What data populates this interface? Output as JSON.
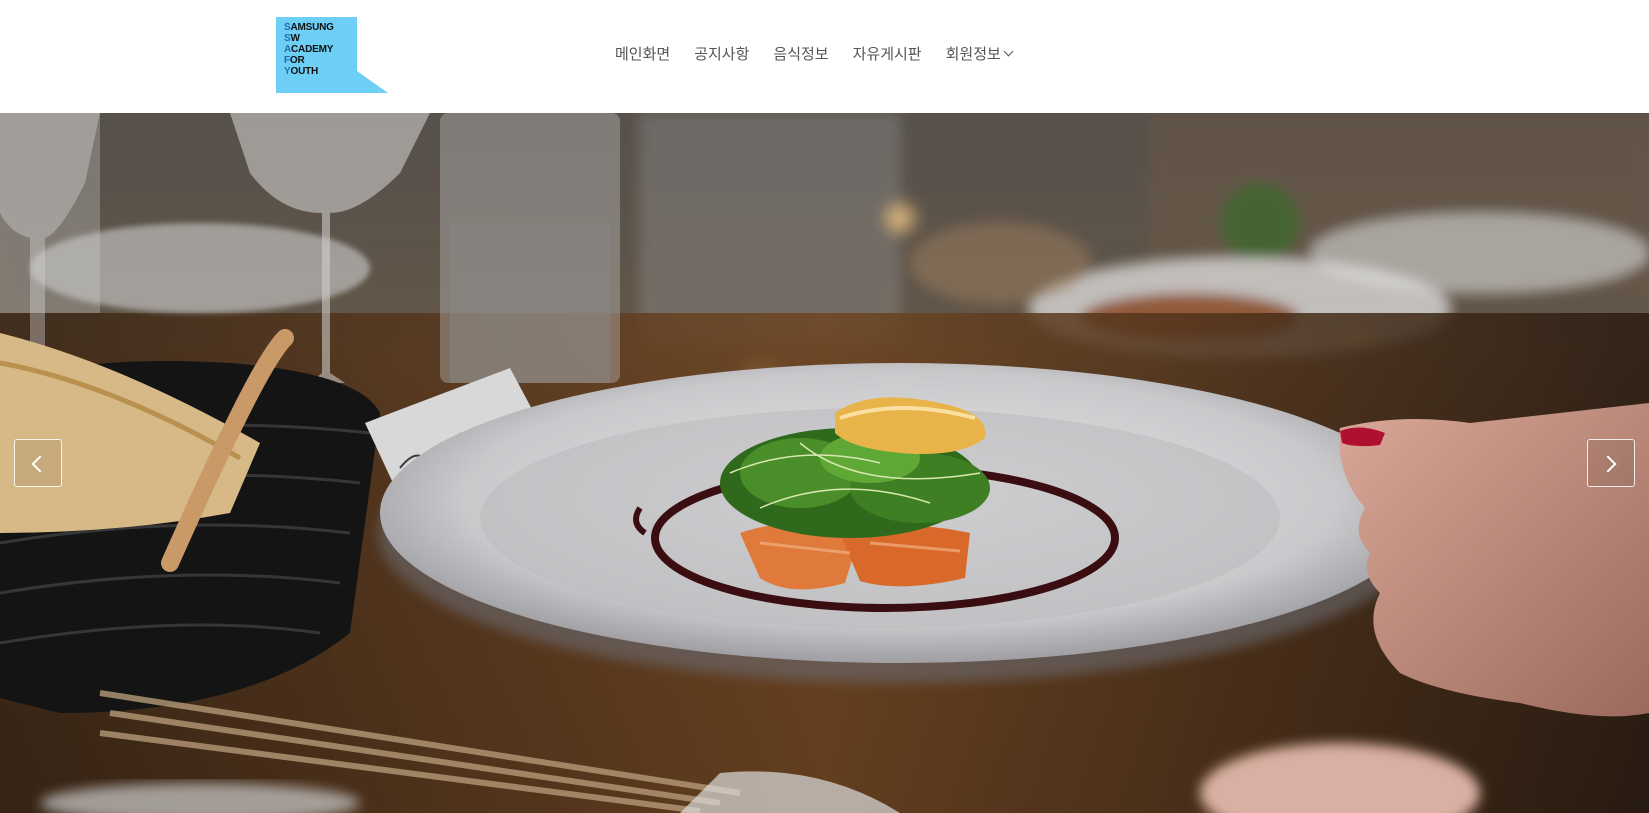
{
  "logo": {
    "lines": [
      "SAMSUNG",
      "SW",
      "ACADEMY",
      "FOR",
      "YOUTH"
    ],
    "initial_letters": [
      "S",
      "S",
      "A",
      "F",
      "Y"
    ],
    "line_rests": [
      "AMSUNG",
      "W",
      "CADEMY",
      "OR",
      "OUTH"
    ],
    "background_color": "#6ecff6",
    "initial_color": "#1f6fb0"
  },
  "nav": {
    "items": [
      {
        "label": "메인화면"
      },
      {
        "label": "공지사항"
      },
      {
        "label": "음식정보"
      },
      {
        "label": "자유게시판"
      },
      {
        "label": "회원정보",
        "has_dropdown": true
      }
    ]
  },
  "hero": {
    "image_subject": "restaurant-dish-photo"
  },
  "carousel": {
    "prev_icon": "chevron-left-icon",
    "next_icon": "chevron-right-icon"
  }
}
